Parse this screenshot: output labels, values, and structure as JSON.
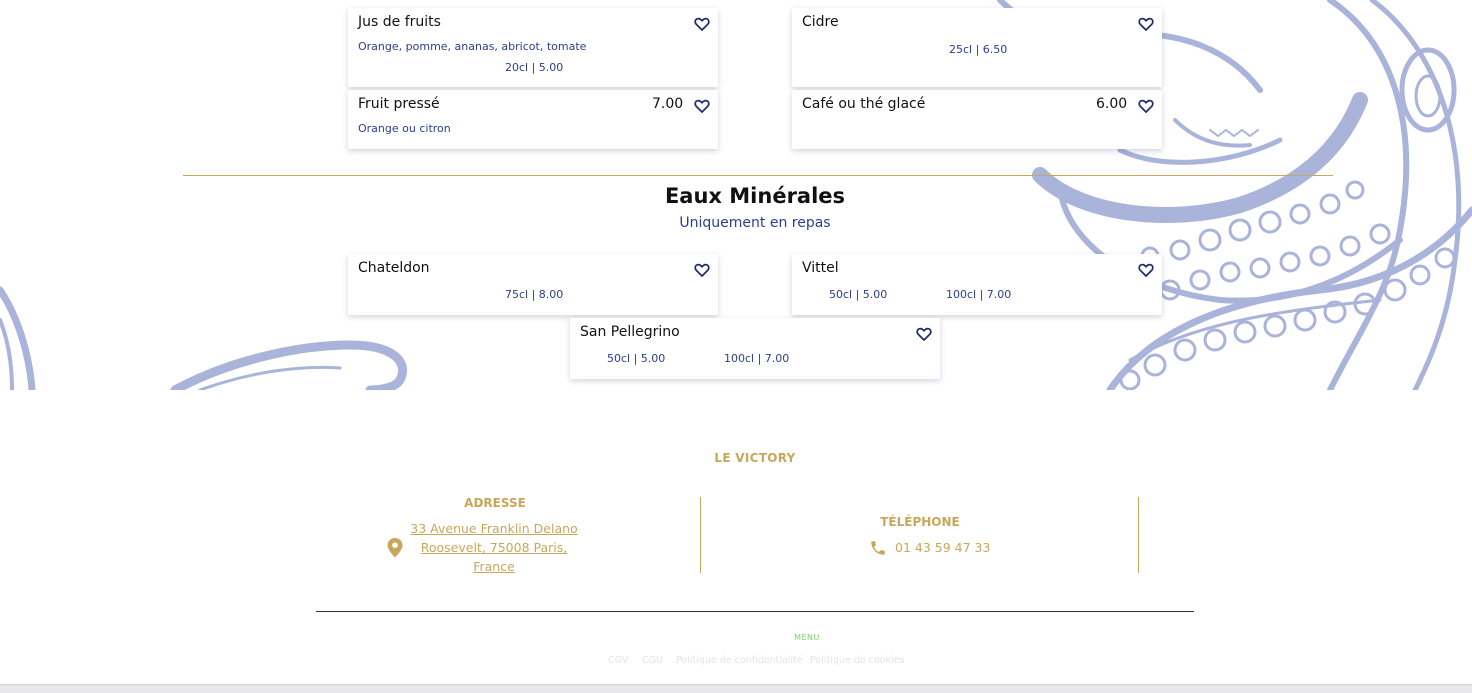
{
  "colors": {
    "accent_gold": "#c9a75a",
    "text_blue": "#2c3e8c",
    "heart_navy": "#1f2e6b",
    "illustration": "#aab3d9"
  },
  "cards_top": [
    {
      "name": "Jus de fruits",
      "desc": "Orange, pomme, ananas, abricot, tomate",
      "prices": [
        "20cl | 5.00"
      ]
    },
    {
      "name": "Cidre",
      "prices": [
        "25cl | 6.50"
      ]
    },
    {
      "name": "Fruit pressé",
      "price": "7.00",
      "desc": "Orange ou citron"
    },
    {
      "name": "Café ou thé glacé",
      "price": "6.00"
    }
  ],
  "section": {
    "title": "Eaux Minérales",
    "subtitle": "Uniquement en repas"
  },
  "cards_water": [
    {
      "name": "Chateldon",
      "prices": [
        "75cl | 8.00"
      ]
    },
    {
      "name": "Vittel",
      "prices": [
        "50cl | 5.00",
        "100cl | 7.00"
      ]
    },
    {
      "name": "San Pellegrino",
      "prices": [
        "50cl | 5.00",
        "100cl | 7.00"
      ]
    }
  ],
  "footer": {
    "brand": "LE VICTORY",
    "address_title": "ADRESSE",
    "address_lines": [
      "33 Avenue Franklin Delano",
      "Roosevelt, 75008 Paris,",
      "France"
    ],
    "phone_title": "TÉLÉPHONE",
    "phone": "01 43 59 47 33",
    "menu_label": "MENU",
    "legal": [
      "CGV",
      "CGU",
      "Politique de confidentialité",
      "Politique de cookies"
    ]
  },
  "icons": {
    "favorite": "heart-outline-icon",
    "address": "map-pin-icon",
    "phone": "phone-icon"
  }
}
